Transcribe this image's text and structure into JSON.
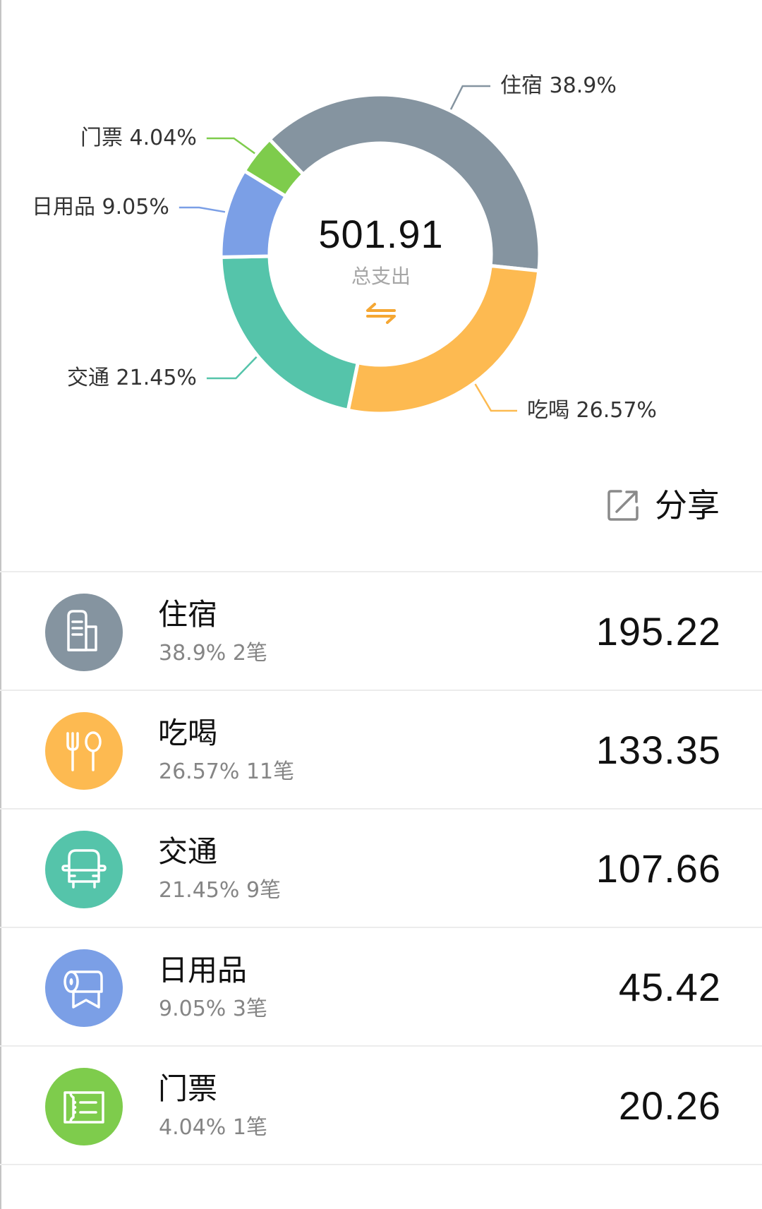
{
  "center": {
    "total": "501.91",
    "label": "总支出",
    "swap_icon": "swap-arrows-icon"
  },
  "share": {
    "label": "分享",
    "icon": "share-external-icon"
  },
  "chart_data": {
    "type": "pie",
    "variant": "donut",
    "title": "",
    "total": 501.91,
    "total_label": "总支出",
    "categories": [
      "住宿",
      "吃喝",
      "交通",
      "日用品",
      "门票"
    ],
    "values": [
      195.22,
      133.35,
      107.66,
      45.42,
      20.26
    ],
    "percentages": [
      38.9,
      26.57,
      21.45,
      9.05,
      4.04
    ],
    "labels": [
      "住宿 38.9%",
      "吃喝 26.57%",
      "交通 21.45%",
      "日用品 9.05%",
      "门票 4.04%"
    ],
    "colors": [
      "#8594A0",
      "#FDBA51",
      "#55C4AA",
      "#7B9FE6",
      "#7ECC4C"
    ],
    "legend": "none"
  },
  "categories": [
    {
      "name": "住宿",
      "percent": "38.9%",
      "count": "2笔",
      "amount": "195.22",
      "color": "#8594A0",
      "icon": "hotel-building-icon"
    },
    {
      "name": "吃喝",
      "percent": "26.57%",
      "count": "11笔",
      "amount": "133.35",
      "color": "#FDBA51",
      "icon": "fork-spoon-icon"
    },
    {
      "name": "交通",
      "percent": "21.45%",
      "count": "9笔",
      "amount": "107.66",
      "color": "#55C4AA",
      "icon": "bus-icon"
    },
    {
      "name": "日用品",
      "percent": "9.05%",
      "count": "3笔",
      "amount": "45.42",
      "color": "#7B9FE6",
      "icon": "tissue-roll-icon"
    },
    {
      "name": "门票",
      "percent": "4.04%",
      "count": "1笔",
      "amount": "20.26",
      "color": "#7ECC4C",
      "icon": "ticket-icon"
    }
  ]
}
